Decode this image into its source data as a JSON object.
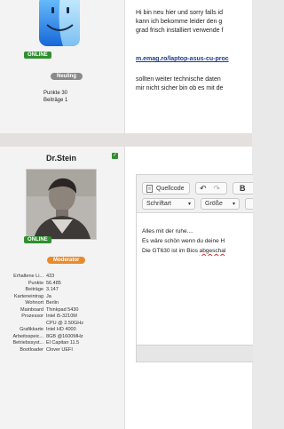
{
  "post1": {
    "online_badge": "ONLINE",
    "rank_badge": "Neuling",
    "punkte": "Punkte 30",
    "beitraege": "Beiträge 1",
    "lines": [
      "Hi bin neu hier und sorry falls id",
      "kann ich bekomme leider den g",
      "grad frisch installiert verwende f"
    ],
    "link": "m.emag.ro/laptop-asus-cu-proc",
    "lines2": [
      "sollten weiter technische daten",
      "mir nicht sicher bin ob es mit de"
    ]
  },
  "post2": {
    "username": "Dr.Stein",
    "online_badge": "ONLINE",
    "rank_badge": "Moderator",
    "stats": [
      {
        "k": "Erhaltene Li...",
        "v": "433"
      },
      {
        "k": "Punkte",
        "v": "56.485"
      },
      {
        "k": "Beiträge",
        "v": "3.147"
      },
      {
        "k": "Karteneintrag",
        "v": "Ja"
      },
      {
        "k": "Wohnort",
        "v": "Berlin"
      },
      {
        "k": "Mainboard",
        "v": "Thinkpad 5430"
      },
      {
        "k": "Prozessor",
        "v": "Intel i5-3210M"
      },
      {
        "k": "",
        "v": "CPU @ 2.50GHz"
      },
      {
        "k": "Grafikkarte",
        "v": "Intel HD 4000"
      },
      {
        "k": "Arbeitsspeic...",
        "v": "8GB @1600MHz"
      },
      {
        "k": "Betriebssyst...",
        "v": "El Capitan 11.5"
      },
      {
        "k": "Bootloader",
        "v": "Clover UEFI"
      }
    ],
    "editor": {
      "source_button": "Quellcode",
      "bold_button": "B",
      "font_select": "Schriftart",
      "size_select": "Größe",
      "lines": [
        "Alles mit der ruhe....",
        "Es wäre schön wenn du deine H",
        "Die GT630 ist im Bios "
      ],
      "misspelled": "abgeschal"
    }
  },
  "colors": {
    "online": "#2f8f2f",
    "moderator": "#e88b2e",
    "link": "#1a3c8a"
  }
}
